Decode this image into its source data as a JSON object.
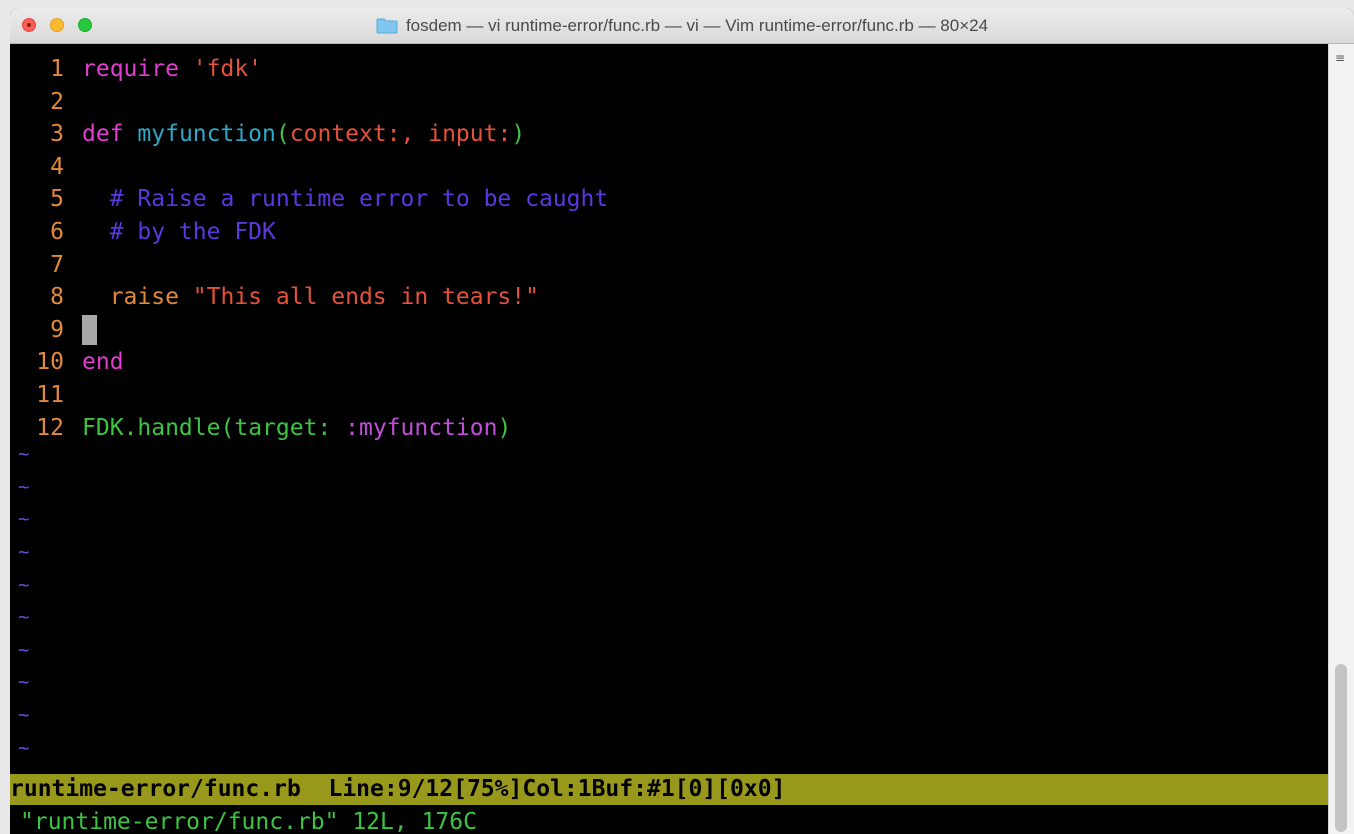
{
  "window": {
    "title": "fosdem — vi runtime-error/func.rb — vi — Vim runtime-error/func.rb — 80×24"
  },
  "editor": {
    "lines": [
      {
        "num": "1",
        "parts": [
          {
            "t": "require",
            "c": "kw-pink"
          },
          {
            "t": " ",
            "c": ""
          },
          {
            "t": "'fdk'",
            "c": "str-red"
          }
        ]
      },
      {
        "num": "2",
        "parts": []
      },
      {
        "num": "3",
        "parts": [
          {
            "t": "def",
            "c": "kw-pink"
          },
          {
            "t": " ",
            "c": ""
          },
          {
            "t": "myfunction",
            "c": "fn-cyan"
          },
          {
            "t": "(",
            "c": "paren-green"
          },
          {
            "t": "context:",
            "c": "param-red"
          },
          {
            "t": ", ",
            "c": "param-red"
          },
          {
            "t": "input:",
            "c": "param-red"
          },
          {
            "t": ")",
            "c": "paren-green"
          }
        ]
      },
      {
        "num": "4",
        "parts": []
      },
      {
        "num": "5",
        "parts": [
          {
            "t": "  # Raise a runtime error to be caught",
            "c": "cmt-blue"
          }
        ]
      },
      {
        "num": "6",
        "parts": [
          {
            "t": "  # by the FDK",
            "c": "cmt-blue"
          }
        ]
      },
      {
        "num": "7",
        "parts": []
      },
      {
        "num": "8",
        "parts": [
          {
            "t": "  raise",
            "c": "raise-orange"
          },
          {
            "t": " ",
            "c": ""
          },
          {
            "t": "\"This all ends in tears!\"",
            "c": "str-red"
          }
        ]
      },
      {
        "num": "9",
        "parts": [],
        "cursor": true
      },
      {
        "num": "10",
        "parts": [
          {
            "t": "end",
            "c": "kw-pink"
          }
        ]
      },
      {
        "num": "11",
        "parts": []
      },
      {
        "num": "12",
        "parts": [
          {
            "t": "FDK.handle",
            "c": "green"
          },
          {
            "t": "(",
            "c": "green"
          },
          {
            "t": "target:",
            "c": "green"
          },
          {
            "t": " ",
            "c": ""
          },
          {
            "t": ":myfunction",
            "c": "sym-purple"
          },
          {
            "t": ")",
            "c": "green"
          }
        ]
      }
    ],
    "empty_line_marker": "~",
    "empty_line_count": 10
  },
  "status_line": {
    "text": "runtime-error/func.rb  Line:9/12[75%]Col:1Buf:#1[0][0x0]"
  },
  "message_line": {
    "text": "\"runtime-error/func.rb\" 12L, 176C"
  },
  "colors": {
    "status_bg": "#98981c",
    "line_number": "#e28a3c",
    "keyword": "#e23ed1",
    "string": "#e4523c",
    "function": "#2fa8c7",
    "comment": "#5a38e0",
    "green": "#3ec443",
    "tilde": "#6b4bdc"
  }
}
